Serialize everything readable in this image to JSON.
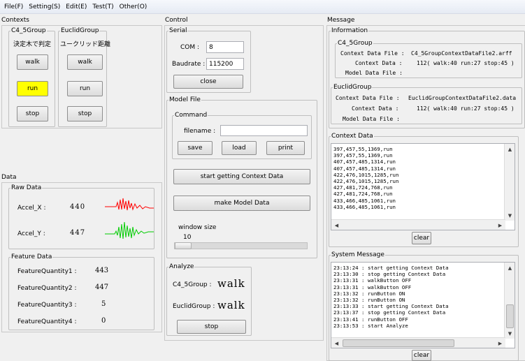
{
  "menu": {
    "items": [
      "File(F)",
      "Setting(S)",
      "Edit(E)",
      "Test(T)",
      "Other(O)"
    ]
  },
  "contexts": {
    "title": "Contexts",
    "c45": {
      "title": "C4_5Group",
      "subtitle": "決定木で判定",
      "walk": "walk",
      "run": "run",
      "stop": "stop",
      "active": "run"
    },
    "euclid": {
      "title": "EuclidGroup",
      "subtitle": "ユークリッド距離",
      "walk": "walk",
      "run": "run",
      "stop": "stop"
    }
  },
  "data": {
    "title": "Data",
    "raw": {
      "title": "Raw Data",
      "accel_x_label": "Accel_X :",
      "accel_x_value": "440",
      "accel_y_label": "Accel_Y :",
      "accel_y_value": "447",
      "accel_x_color": "#ff0000",
      "accel_y_color": "#00cc00"
    },
    "feature": {
      "title": "Feature Data",
      "items": [
        {
          "label": "FeatureQuantity1 :",
          "value": "443"
        },
        {
          "label": "FeatureQuantity2 :",
          "value": "447"
        },
        {
          "label": "FeatureQuantity3 :",
          "value": "5"
        },
        {
          "label": "FeatureQuantity4 :",
          "value": "0"
        }
      ]
    }
  },
  "control": {
    "title": "Control",
    "serial": {
      "title": "Serial",
      "com_label": "COM :",
      "com_value": "8",
      "baud_label": "Baudrate :",
      "baud_value": "115200",
      "close": "close"
    },
    "model": {
      "title": "Model File",
      "command_title": "Command",
      "filename_label": "filename :",
      "filename_value": "",
      "save": "save",
      "load": "load",
      "print": "print",
      "start": "start getting Context Data",
      "make": "make Model Data",
      "window_label": "window size",
      "window_value": "10",
      "window_min": 0,
      "window_max": 100,
      "window_fraction": 0.1
    },
    "analyze": {
      "title": "Analyze",
      "c45_label": "C4_5Group :",
      "c45_value": "walk",
      "euclid_label": "EuclidGroup :",
      "euclid_value": "walk",
      "stop": "stop"
    }
  },
  "message": {
    "title": "Message",
    "info": {
      "title": "Information",
      "c45": {
        "title": "C4_5Group",
        "file_label": "Context Data File :",
        "file_value": "C4_5GroupContextDataFile2.arff",
        "data_label": "Context Data :",
        "data_value": "112( walk:40 run:27 stop:45 )",
        "model_label": "Model Data File :",
        "model_value": ""
      },
      "euclid": {
        "title": "EuclidGroup",
        "file_label": "Context Data File :",
        "file_value": "EuclidGroupContextDataFile2.data",
        "data_label": "Context Data :",
        "data_value": "112( walk:40 run:27 stop:45 )",
        "model_label": "Model Data File :",
        "model_value": ""
      }
    },
    "context_data": {
      "title": "Context Data",
      "rows": [
        "397,457,55,1369,run",
        "397,457,55,1369,run",
        "407,457,485,1314,run",
        "407,457,485,1314,run",
        "422,476,1015,1285,run",
        "422,476,1015,1285,run",
        "427,481,724,768,run",
        "427,481,724,768,run",
        "433,466,485,1061,run",
        "433,466,485,1061,run"
      ],
      "clear": "clear"
    },
    "system": {
      "title": "System Message",
      "rows": [
        "23:13:24 : start getting Context Data",
        "23:13:30 : stop getting Context Data",
        "23:13:31 : walkButton OFF",
        "23:13:31 : walkButton OFF",
        "23:13:32 : runButton ON",
        "23:13:32 : runButton ON",
        "23:13:33 : start getting Context Data",
        "23:13:37 : stop getting Context Data",
        "23:13:41 : runButton OFF",
        "23:13:53 : start Analyze"
      ],
      "clear": "clear"
    }
  }
}
